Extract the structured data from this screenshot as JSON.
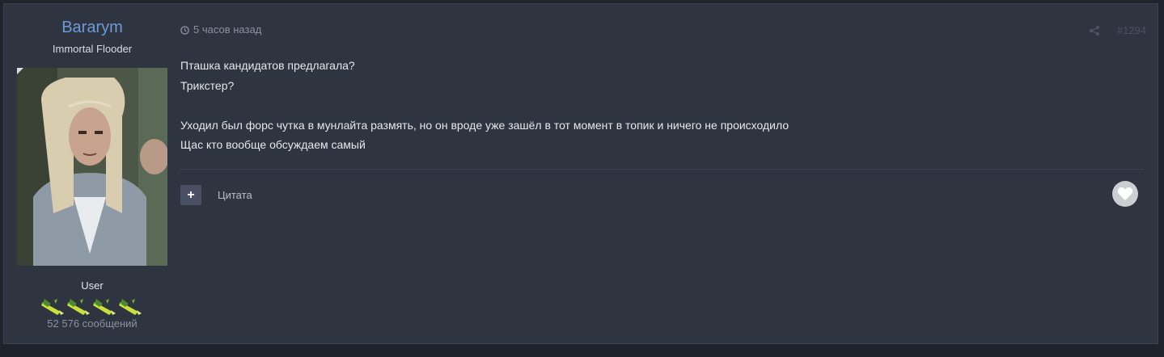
{
  "author": {
    "name": "Bararym",
    "title": "Immortal Flooder",
    "group": "User",
    "post_count": "52 576 сообщений",
    "badge_count": 4
  },
  "post": {
    "time": "5 часов назад",
    "number": "#1294",
    "lines": [
      "Пташка кандидатов предлагала?",
      "Трикстер?",
      "",
      "Уходил был форс чутка в мунлайта размять, но он вроде уже зашёл в тот момент в топик и ничего не происходило",
      "Щас кто вообще обсуждаем самый"
    ]
  },
  "actions": {
    "plus_label": "+",
    "quote_label": "Цитата"
  },
  "colors": {
    "page_bg": "#1f232b",
    "post_bg": "#2f3441",
    "author_name": "#6e9ad6",
    "text": "#e6e8ec",
    "muted": "#8b919e"
  },
  "icons": [
    "clock-icon",
    "share-icon",
    "heart-icon",
    "plus-icon",
    "badge-icon"
  ]
}
